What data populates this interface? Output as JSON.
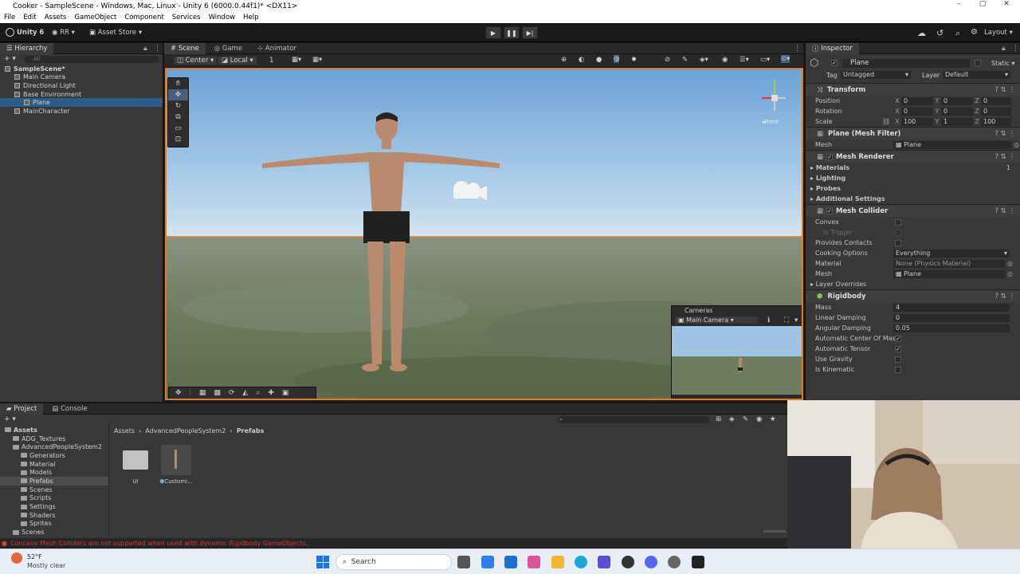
{
  "window": {
    "title": "Cooker - SampleScene - Windows, Mac, Linux - Unity 6 (6000.0.44f1)* <DX11>"
  },
  "menu": [
    "File",
    "Edit",
    "Assets",
    "GameObject",
    "Component",
    "Services",
    "Window",
    "Help"
  ],
  "toolbar": {
    "unity_label": "Unity 6",
    "account": "RR",
    "asset_store": "Asset Store",
    "layout": "Layout"
  },
  "hierarchy": {
    "tab": "Hierarchy",
    "search_placeholder": "All",
    "items": [
      {
        "label": "SampleScene*",
        "indent": 0,
        "selected": false
      },
      {
        "label": "Main Camera",
        "indent": 1,
        "selected": false
      },
      {
        "label": "Directional Light",
        "indent": 1,
        "selected": false
      },
      {
        "label": "Base Environment",
        "indent": 1,
        "selected": false
      },
      {
        "label": "Plane",
        "indent": 2,
        "selected": true
      },
      {
        "label": "MainCharacter",
        "indent": 1,
        "selected": false
      }
    ]
  },
  "scene": {
    "tabs": [
      "Scene",
      "Game",
      "Animator"
    ],
    "pivot": "Center",
    "space": "Local",
    "snap": "1",
    "gizmo_label": "Front",
    "cameras_overlay": {
      "title": "Cameras",
      "selected": "Main Camera"
    }
  },
  "inspector": {
    "tab": "Inspector",
    "object_name": "Plane",
    "static_label": "Static",
    "tag_label": "Tag",
    "tag": "Untagged",
    "layer_label": "Layer",
    "layer": "Default",
    "transform": {
      "title": "Transform",
      "position_label": "Position",
      "position": [
        "0",
        "0",
        "0"
      ],
      "rotation_label": "Rotation",
      "rotation": [
        "0",
        "0",
        "0"
      ],
      "scale_label": "Scale",
      "scale": [
        "100",
        "1",
        "100"
      ]
    },
    "mesh_filter": {
      "title": "Plane (Mesh Filter)",
      "mesh_label": "Mesh",
      "mesh": "Plane"
    },
    "mesh_renderer": {
      "title": "Mesh Renderer",
      "materials": "Materials",
      "materials_count": "1",
      "lighting": "Lighting",
      "probes": "Probes",
      "additional": "Additional Settings"
    },
    "mesh_collider": {
      "title": "Mesh Collider",
      "convex": "Convex",
      "is_trigger": "Is Trigger",
      "provides_contacts": "Provides Contacts",
      "cooking_label": "Cooking Options",
      "cooking": "Everything",
      "material_label": "Material",
      "material": "None (Physics Material)",
      "mesh_label": "Mesh",
      "mesh": "Plane",
      "layer_overrides": "Layer Overrides"
    },
    "rigidbody": {
      "title": "Rigidbody",
      "mass_label": "Mass",
      "mass": "4",
      "linear_label": "Linear Damping",
      "linear": "0",
      "angular_label": "Angular Damping",
      "angular": "0.05",
      "auto_com": "Automatic Center Of Mas",
      "auto_tensor": "Automatic Tensor",
      "gravity": "Use Gravity",
      "kinematic": "Is Kinematic"
    }
  },
  "project": {
    "tabs": [
      "Project",
      "Console"
    ],
    "breadcrumb": [
      "Assets",
      "AdvancedPeopleSystem2",
      "Prefabs"
    ],
    "tree": [
      {
        "label": "Assets",
        "indent": 0,
        "bold": true
      },
      {
        "label": "ADG_Textures",
        "indent": 1
      },
      {
        "label": "AdvancedPeopleSystem2",
        "indent": 1
      },
      {
        "label": "Generators",
        "indent": 2
      },
      {
        "label": "Material",
        "indent": 2
      },
      {
        "label": "Models",
        "indent": 2
      },
      {
        "label": "Prefabs",
        "indent": 2,
        "selected": true
      },
      {
        "label": "Scenes",
        "indent": 2
      },
      {
        "label": "Scripts",
        "indent": 2
      },
      {
        "label": "Settings",
        "indent": 2
      },
      {
        "label": "Shaders",
        "indent": 2
      },
      {
        "label": "Sprites",
        "indent": 2
      },
      {
        "label": "Scenes",
        "indent": 1
      }
    ],
    "assets": [
      {
        "label": "UI",
        "kind": "folder"
      },
      {
        "label": "Customi...",
        "kind": "prefab"
      }
    ]
  },
  "status": {
    "message": "Concave Mesh Colliders are not supported when used with dynamic Rigidbody GameObjects."
  },
  "taskbar": {
    "temp": "52°F",
    "weather": "Mostly clear",
    "search": "Search"
  }
}
